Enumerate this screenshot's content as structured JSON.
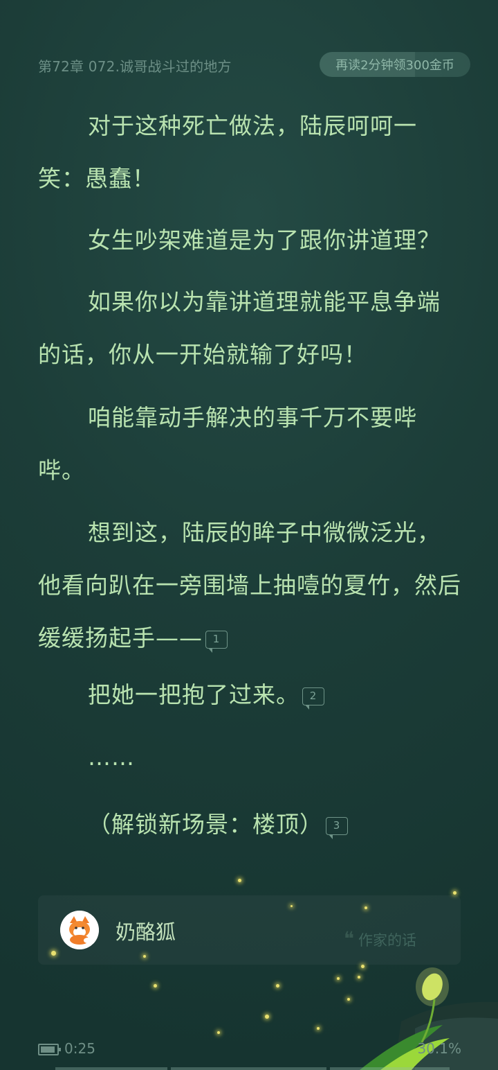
{
  "header": {
    "chapter_title": "第72章 072.诚哥战斗过的地方",
    "reward_pill": "再读2分钟领300金币"
  },
  "paragraphs": [
    "对于这种死亡做法，陆辰呵呵一笑：愚蠢！",
    "女生吵架难道是为了跟你讲道理？",
    "如果你以为靠讲道理就能平息争端的话，你从一开始就输了好吗！",
    "咱能靠动手解决的事千万不要哔哔。",
    "想到这，陆辰的眸子中微微泛光，他看向趴在一旁围墙上抽噎的夏竹，然后缓缓扬起手——",
    "把她一把抱了过来。",
    "……",
    "（解锁新场景：楼顶）"
  ],
  "notes": [
    "1",
    "2",
    "3"
  ],
  "author": {
    "name": "奶酪狐",
    "words_label": "作家的话"
  },
  "status": {
    "time": "0:25",
    "progress": "30.1%"
  }
}
